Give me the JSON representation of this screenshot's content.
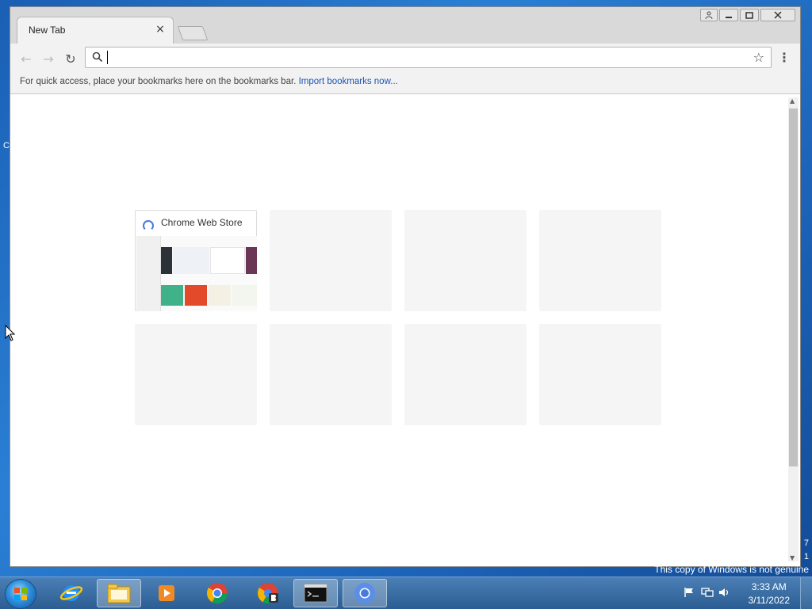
{
  "browser": {
    "tab": {
      "title": "New Tab",
      "close_glyph": "×"
    },
    "omnibox": {
      "value": "",
      "placeholder": ""
    },
    "bookmarks_bar": {
      "message": "For quick access, place your bookmarks here on the bookmarks bar.",
      "link": "Import bookmarks now..."
    },
    "most_visited": [
      {
        "title": "Chrome Web Store"
      }
    ],
    "icons": {
      "back": "←",
      "forward": "→",
      "reload": "↻",
      "star": "☆",
      "menu": "⋮",
      "close": "✕",
      "minimize": "—",
      "maximize": "□",
      "user": "👤"
    }
  },
  "taskbar": {
    "clock_time": "3:33 AM",
    "clock_date": "3/11/2022"
  },
  "desktop": {
    "genuine_notice": "This copy of Windows is not genuine",
    "build_digit_1": "7",
    "build_digit_2": "1",
    "edge_letter": "C"
  },
  "colors": {
    "desktop_blue": "#1a5fb4",
    "link_blue": "#1a56b5",
    "tile_grey": "#f5f5f5"
  }
}
